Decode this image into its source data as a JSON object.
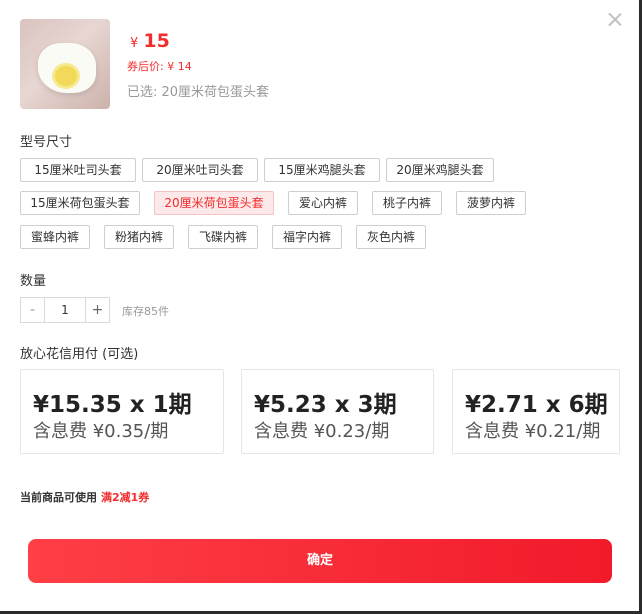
{
  "product": {
    "price_symbol": "¥",
    "price": "15",
    "coupon_price": "券后价: ¥ 14",
    "selected": "已选: 20厘米荷包蛋头套"
  },
  "size_section": {
    "title": "型号尺寸",
    "options": [
      "15厘米吐司头套",
      "20厘米吐司头套",
      "15厘米鸡腿头套",
      "20厘米鸡腿头套",
      "15厘米荷包蛋头套",
      "20厘米荷包蛋头套",
      "爱心内裤",
      "桃子内裤",
      "菠萝内裤",
      "蜜蜂内裤",
      "粉猪内裤",
      "飞碟内裤",
      "福字内裤",
      "灰色内裤"
    ],
    "selected_index": 5
  },
  "quantity_section": {
    "title": "数量",
    "minus": "-",
    "value": "1",
    "plus": "+",
    "stock": "库存85件"
  },
  "installment_section": {
    "title": "放心花信用付 (可选)",
    "plans": [
      {
        "main": "¥15.35 x 1期",
        "sub": "含息费 ¥0.35/期"
      },
      {
        "main": "¥5.23 x 3期",
        "sub": "含息费 ¥0.23/期"
      },
      {
        "main": "¥2.71 x 6期",
        "sub": "含息费 ¥0.21/期"
      }
    ]
  },
  "coupon": {
    "text": "当前商品可使用",
    "highlight": "满2减1券"
  },
  "confirm_label": "确定",
  "colors": {
    "accent": "#f22d2d",
    "button_start": "#ff3f45",
    "button_end": "#f11a2a"
  }
}
